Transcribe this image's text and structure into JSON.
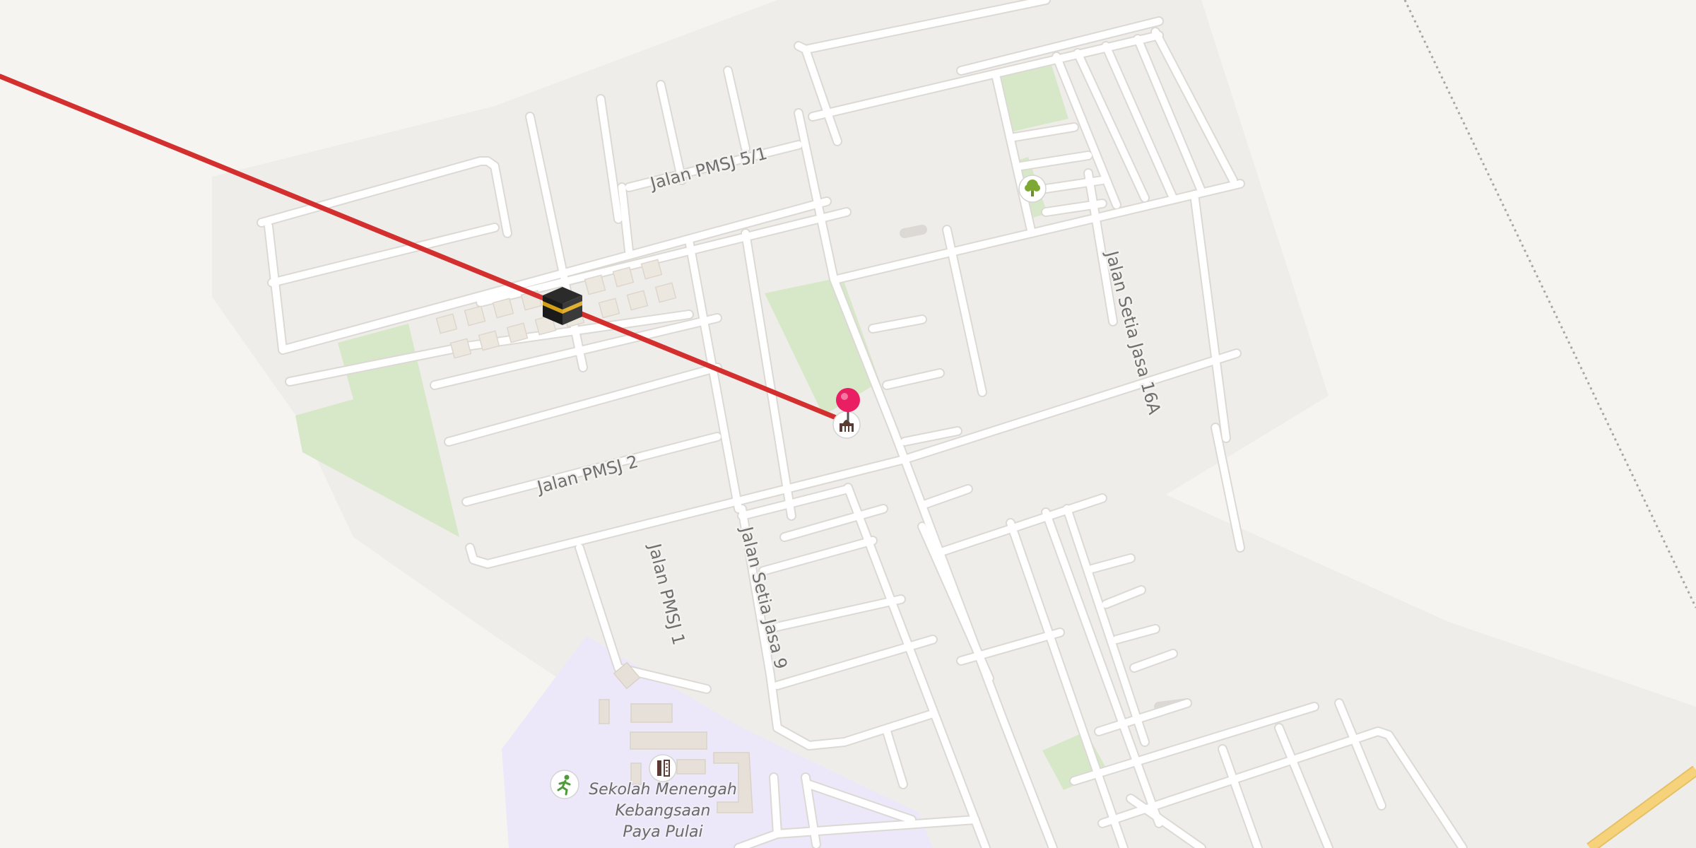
{
  "colors": {
    "background": "#f6f4f1",
    "residential": "#efedea",
    "park": "#d7e8c8",
    "school_area": "#ece8f9",
    "road": "#ffffff",
    "road_casing": "#dcd9d4",
    "route_line": "#d32f2f",
    "pin": "#e91e63",
    "highway": "#f6d27a"
  },
  "streets": [
    {
      "name": "Jalan PMSJ 5/1"
    },
    {
      "name": "Jalan PMSJ 2"
    },
    {
      "name": "Jalan PMSJ 1"
    },
    {
      "name": "Jalan Setia Jasa 9"
    },
    {
      "name": "Jalan Setia Jasa 16A"
    }
  ],
  "school": {
    "lines": [
      "Sekolah Menengah",
      "Kebangsaan",
      "Paya Pulai"
    ]
  },
  "icons": {
    "kaaba": "kaaba-icon",
    "pin": "location-pin-icon",
    "mosque": "mosque-icon",
    "park": "tree-icon",
    "school": "school-icon",
    "sports": "running-person-icon"
  }
}
